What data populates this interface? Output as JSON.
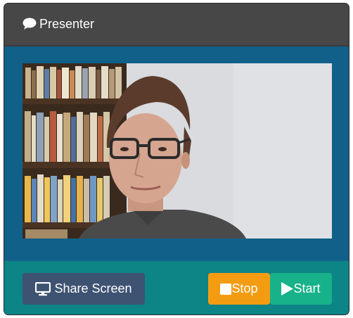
{
  "panel": {
    "title": "Presenter",
    "title_icon": "comment-icon"
  },
  "video": {
    "description_icon": "webcam-video"
  },
  "controls": {
    "share_label": "Share Screen",
    "share_icon": "monitor-icon",
    "stop_label": "Stop",
    "stop_icon": "stop-square-icon",
    "start_label": "Start",
    "start_icon": "play-icon"
  },
  "colors": {
    "header_bg": "#474747",
    "body_bg": "#116089",
    "footer_bg": "#0d8486",
    "share_button": "#3e5272",
    "stop_button": "#f39c12",
    "start_button": "#17b28a"
  }
}
